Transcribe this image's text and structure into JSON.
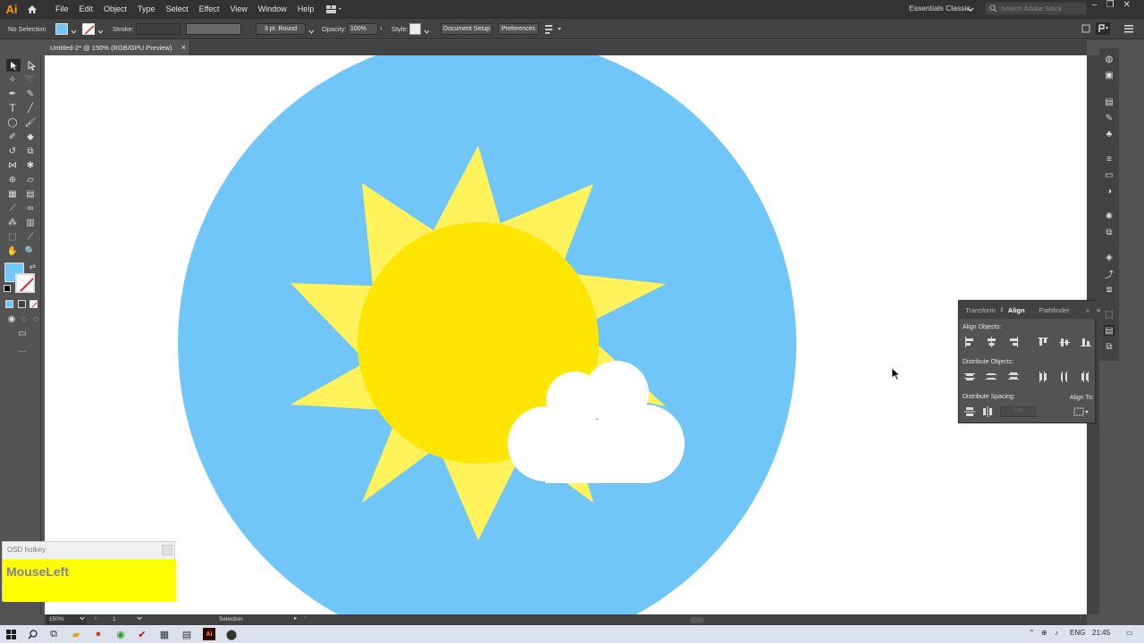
{
  "app": {
    "logo": "Ai"
  },
  "menubar": {
    "items": [
      "File",
      "Edit",
      "Object",
      "Type",
      "Select",
      "Effect",
      "View",
      "Window",
      "Help"
    ],
    "workspace": "Essentials Classic",
    "search_placeholder": "Search Adobe Stock"
  },
  "controlbar": {
    "selection_label": "No Selection",
    "stroke_label": "Stroke:",
    "brush_label": "3 pt. Round",
    "opacity_label": "Opacity:",
    "opacity_value": "100%",
    "style_label": "Style:",
    "document_setup": "Document Setup",
    "preferences": "Preferences"
  },
  "document": {
    "tab_title": "Untitled-2* @ 150% (RGB/GPU Preview)",
    "tab_close": "×"
  },
  "colors": {
    "sky": "#70c6f9",
    "sun_core": "#ffe600",
    "sun_rays": "#fff25a",
    "cloud": "#ffffff",
    "fill_swatch": "#70c6f9"
  },
  "align_panel": {
    "tabs": [
      "Transform",
      "Align",
      "Pathfinder"
    ],
    "active_tab": "Align",
    "align_objects_label": "Align Objects:",
    "distribute_objects_label": "Distribute Objects:",
    "distribute_spacing_label": "Distribute Spacing:",
    "align_to_label": "Align To:",
    "spacing_value": "0 in"
  },
  "osd": {
    "title": "OSD hotkey",
    "key": "MouseLeft"
  },
  "statusbar": {
    "zoom": "150%",
    "artboard": "1",
    "tool": "Selection"
  },
  "taskbar": {
    "language": "ENG",
    "time": "21:45"
  }
}
